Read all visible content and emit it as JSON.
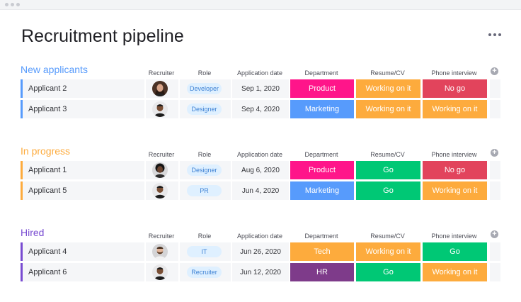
{
  "page": {
    "title": "Recruitment pipeline"
  },
  "columns": {
    "recruiter": "Recruiter",
    "role": "Role",
    "application_date": "Application date",
    "department": "Department",
    "resume": "Resume/CV",
    "phone_interview": "Phone interview"
  },
  "colors": {
    "new_applicants": "#579bfc",
    "in_progress": "#fdab3d",
    "hired": "#784bd1",
    "product": "#ff158a",
    "marketing": "#579bfc",
    "tech": "#fdab3d",
    "hr": "#7e3b8a",
    "working_on_it": "#fdab3d",
    "go": "#00c875",
    "no_go": "#e2445c"
  },
  "groups": [
    {
      "title": "New applicants",
      "rows": [
        {
          "name": "Applicant 2",
          "avatar": "avatar-woman-icon",
          "role": "Developer",
          "date": "Sep 1, 2020",
          "department": "Product",
          "resume": "Working on it",
          "phone": "No go"
        },
        {
          "name": "Applicant 3",
          "avatar": "avatar-man-icon",
          "role": "Designer",
          "date": "Sep 4, 2020",
          "department": "Marketing",
          "resume": "Working on it",
          "phone": "Working on it"
        }
      ]
    },
    {
      "title": "In progress",
      "rows": [
        {
          "name": "Applicant 1",
          "avatar": "avatar-curly-icon",
          "role": "Designer",
          "date": "Aug 6, 2020",
          "department": "Product",
          "resume": "Go",
          "phone": "No go"
        },
        {
          "name": "Applicant 5",
          "avatar": "avatar-man-icon",
          "role": "PR",
          "date": "Jun 4, 2020",
          "department": "Marketing",
          "resume": "Go",
          "phone": "Working on it"
        }
      ]
    },
    {
      "title": "Hired",
      "rows": [
        {
          "name": "Applicant 4",
          "avatar": "avatar-bearded-icon",
          "role": "IT",
          "date": "Jun 26, 2020",
          "department": "Tech",
          "resume": "Working on it",
          "phone": "Go"
        },
        {
          "name": "Applicant 6",
          "avatar": "avatar-man-icon",
          "role": "Recruiter",
          "date": "Jun 12, 2020",
          "department": "HR",
          "resume": "Go",
          "phone": "Working on it"
        }
      ]
    }
  ]
}
